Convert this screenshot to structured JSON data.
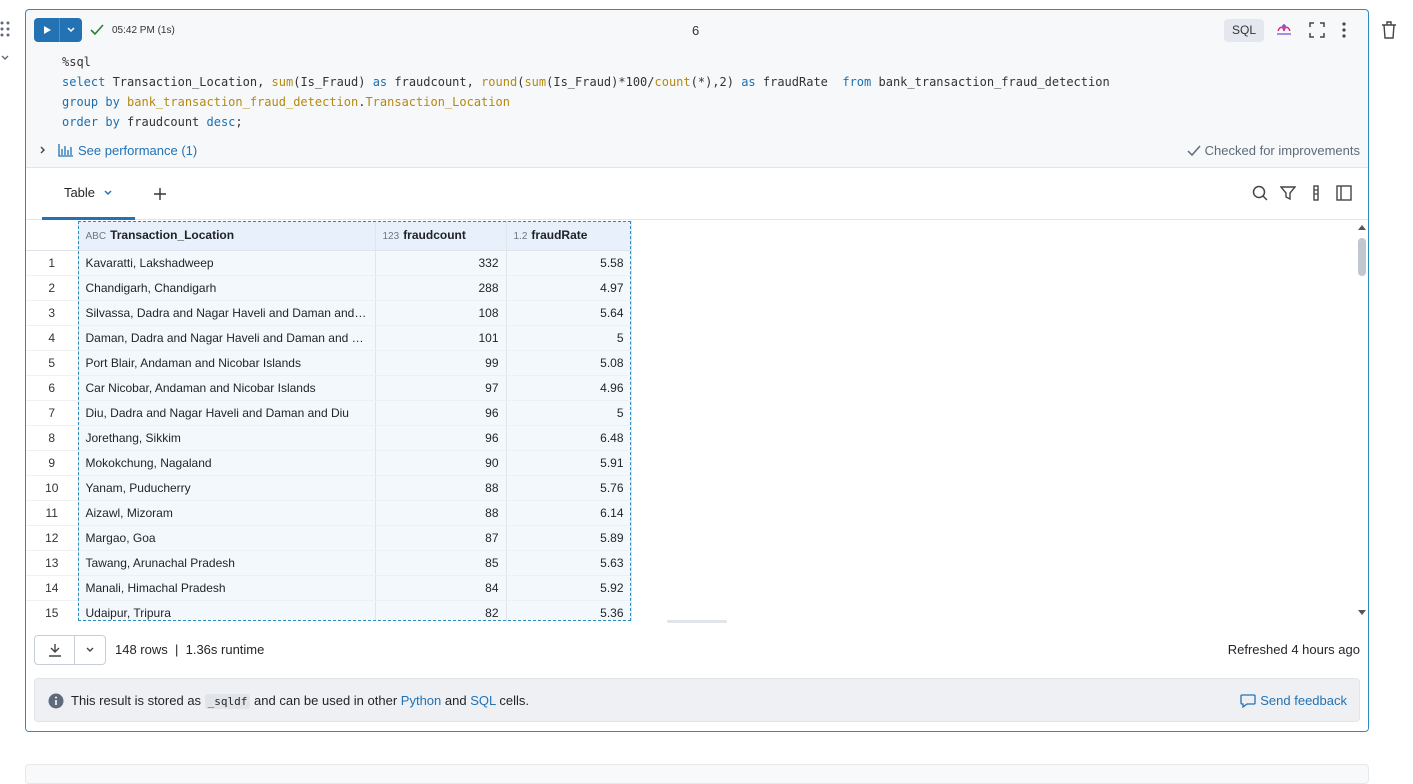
{
  "cell": {
    "exec_time": "05:42 PM (1s)",
    "number": "6",
    "language": "SQL",
    "code_lines": [
      "%sql",
      "select Transaction_Location, sum(Is_Fraud) as fraudcount, round(sum(Is_Fraud)*100/count(*),2) as fraudRate  from bank_transaction_fraud_detection",
      "group by bank_transaction_fraud_detection.Transaction_Location",
      "order by fraudcount desc;"
    ],
    "performance_link": "See performance (1)",
    "checked_label": "Checked for improvements"
  },
  "results": {
    "tab_label": "Table",
    "columns": [
      {
        "type_icon": "ABC",
        "name": "Transaction_Location"
      },
      {
        "type_icon": "123",
        "name": "fraudcount"
      },
      {
        "type_icon": "1.2",
        "name": "fraudRate"
      }
    ],
    "rows": [
      [
        "1",
        "Kavaratti, Lakshadweep",
        "332",
        "5.58"
      ],
      [
        "2",
        "Chandigarh, Chandigarh",
        "288",
        "4.97"
      ],
      [
        "3",
        "Silvassa, Dadra and Nagar Haveli and Daman and D...",
        "108",
        "5.64"
      ],
      [
        "4",
        "Daman, Dadra and Nagar Haveli and Daman and Diu",
        "101",
        "5"
      ],
      [
        "5",
        "Port Blair, Andaman and Nicobar Islands",
        "99",
        "5.08"
      ],
      [
        "6",
        "Car Nicobar, Andaman and Nicobar Islands",
        "97",
        "4.96"
      ],
      [
        "7",
        "Diu, Dadra and Nagar Haveli and Daman and Diu",
        "96",
        "5"
      ],
      [
        "8",
        "Jorethang, Sikkim",
        "96",
        "6.48"
      ],
      [
        "9",
        "Mokokchung, Nagaland",
        "90",
        "5.91"
      ],
      [
        "10",
        "Yanam, Puducherry",
        "88",
        "5.76"
      ],
      [
        "11",
        "Aizawl, Mizoram",
        "88",
        "6.14"
      ],
      [
        "12",
        "Margao, Goa",
        "87",
        "5.89"
      ],
      [
        "13",
        "Tawang, Arunachal Pradesh",
        "85",
        "5.63"
      ],
      [
        "14",
        "Manali, Himachal Pradesh",
        "84",
        "5.92"
      ],
      [
        "15",
        "Udaipur, Tripura",
        "82",
        "5.36"
      ]
    ],
    "row_count": "148 rows",
    "separator": "|",
    "runtime": "1.36s runtime",
    "refreshed": "Refreshed 4 hours ago"
  },
  "info": {
    "prefix": "This result is stored as",
    "var_name": "_sqldf",
    "middle": "and can be used in other",
    "python_link": "Python",
    "and": "and",
    "sql_link": "SQL",
    "suffix": "cells.",
    "feedback": "Send feedback"
  }
}
